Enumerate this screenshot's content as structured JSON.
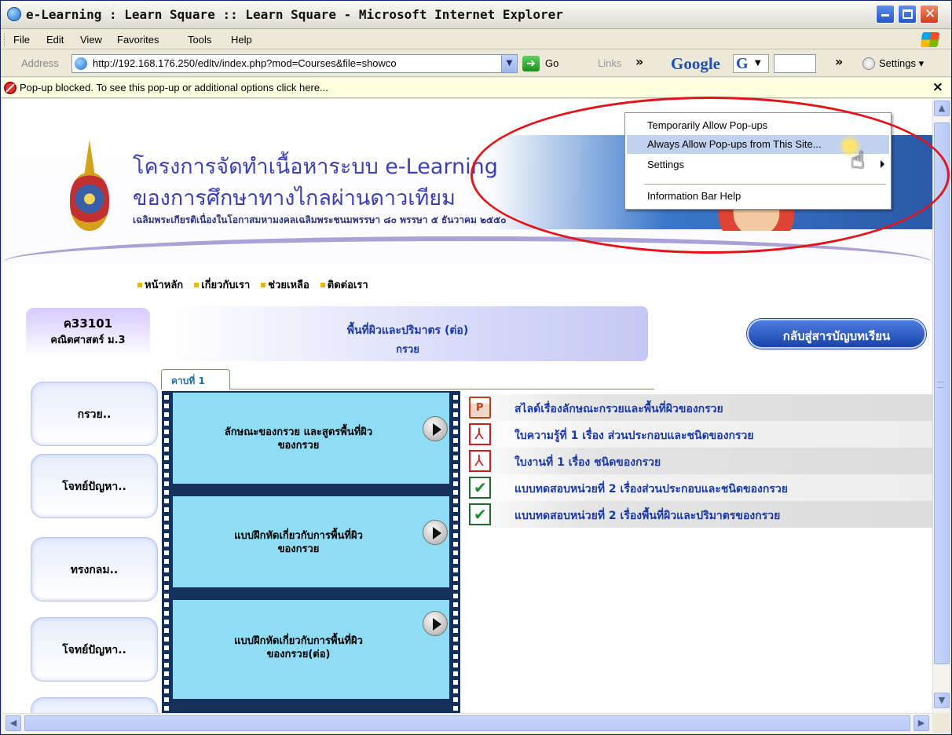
{
  "window": {
    "title": "e-Learning : Learn Square :: Learn Square - Microsoft Internet Explorer",
    "icon": "ie-icon",
    "controls": [
      "minimize",
      "maximize",
      "close"
    ]
  },
  "menubar": {
    "items": [
      "File",
      "Edit",
      "View",
      "Favorites",
      "Tools",
      "Help"
    ]
  },
  "addressbar": {
    "label": "Address",
    "url": "http://192.168.176.250/edltv/index.php?mod=Courses&file=showco",
    "go_label": "Go",
    "links_label": "Links",
    "google_logo": "Google",
    "google_g": "G",
    "settings_label": "Settings"
  },
  "infobar": {
    "text": "Pop-up blocked. To see this pop-up or additional options click here...",
    "close": "×"
  },
  "banner": {
    "title_line1": "โครงการจัดทำเนื้อหาระบบ e-Learning",
    "title_line2": "ของการศึกษาทางไกลผ่านดาวเทียม",
    "subtitle": "เฉลิมพระเกียรติเนื่องในโอกาสมหามงคลเฉลิมพระชนมพรรษา ๘๐ พรรษา ๕ ธันวาคม ๒๕๕๐"
  },
  "topnav": {
    "items": [
      "หน้าหลัก",
      "เกี่ยวกับเรา",
      "ช่วยเหลือ",
      "ติดต่อเรา"
    ]
  },
  "course": {
    "code": "ค33101",
    "name": "คณิตศาสตร์ ม.3"
  },
  "lesson": {
    "title": "พื้นที่ผิวและปริมาตร (ต่อ)",
    "subtitle": "กรวย"
  },
  "back_button": "กลับสู่สารบัญบทเรียน",
  "period_tab": "คาบที่ 1",
  "sidebar": {
    "items": [
      "กรวย..",
      "โจทย์ปัญหา..",
      "ทรงกลม..",
      "โจทย์ปัญหา.."
    ]
  },
  "film": {
    "frames": [
      {
        "line1": "ลักษณะของกรวย และสูตรพื้นที่ผิว",
        "line2": "ของกรวย"
      },
      {
        "line1": "แบบฝึกหัดเกี่ยวกับการพื้นที่ผิว",
        "line2": "ของกรวย"
      },
      {
        "line1": "แบบฝึกหัดเกี่ยวกับการพื้นที่ผิว",
        "line2": "ของกรวย(ต่อ)"
      }
    ]
  },
  "resources": [
    {
      "icon": "ppt-icon",
      "label": "สไลด์เรื่องลักษณะกรวยและพื้นที่ผิวของกรวย"
    },
    {
      "icon": "pdf-icon",
      "label": "ใบความรู้ที่ 1 เรื่อง ส่วนประกอบและชนิดของกรวย"
    },
    {
      "icon": "pdf-icon",
      "label": "ใบงานที่ 1 เรื่อง ชนิดของกรวย"
    },
    {
      "icon": "quiz-icon",
      "label": "แบบทดสอบหน่วยที่ 2 เรื่องส่วนประกอบและชนิดของกรวย"
    },
    {
      "icon": "quiz-icon",
      "label": "แบบทดสอบหน่วยที่ 2 เรื่องพื้นที่ผิวและปริมาตรของกรวย"
    }
  ],
  "popup_menu": {
    "items": [
      {
        "label": "Temporarily Allow Pop-ups",
        "highlighted": false
      },
      {
        "label": "Always Allow Pop-ups from This Site...",
        "highlighted": true
      },
      {
        "label": "Settings",
        "highlighted": false,
        "submenu": true
      },
      {
        "label": "Information Bar Help",
        "highlighted": false
      }
    ]
  },
  "colors": {
    "annotation_ellipse": "#e2141a",
    "menu_highlight": "#c1d2ee",
    "link_blue": "#1a39a8",
    "film_frame": "#8fdcf5"
  }
}
